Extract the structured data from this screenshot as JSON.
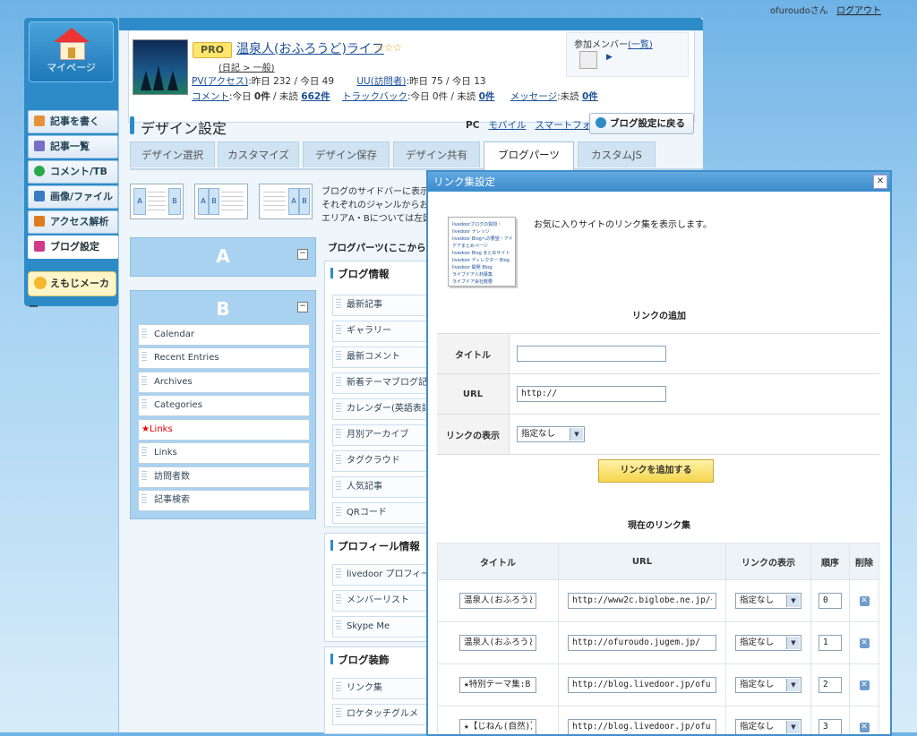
{
  "user": {
    "name": "ofuroudoさん",
    "logout": "ログアウト"
  },
  "nav": {
    "mypage": "マイページ",
    "items": [
      {
        "label": "記事を書く",
        "color": "#e8913a"
      },
      {
        "label": "記事一覧",
        "color": "#7a6fc8"
      },
      {
        "label": "コメント/TB",
        "color": "#2aa84a"
      },
      {
        "label": "画像/ファイル",
        "color": "#3a7cc4"
      },
      {
        "label": "アクセス解析",
        "color": "#e07a1f"
      },
      {
        "label": "ブログ設定",
        "color": "#d23b8a"
      }
    ],
    "emoji": "えもじメーカー"
  },
  "profile": {
    "pro": "PRO",
    "blog_name": "温泉人(おふろうど)ライフ",
    "stars": "☆☆☆",
    "diary": "(日記 > 一般)",
    "pv_label": "PV(アクセス)",
    "pv_text": ":昨日 232 / 今日 49",
    "uu_label": "UU(訪問者)",
    "uu_text": ":昨日 75 / 今日 13",
    "comment_label": "コメント",
    "comment_text": ":今日 ",
    "comment_today": "0件",
    "comment_mid": " / 未読 ",
    "comment_unread": "662件",
    "tb_label": "トラックバック",
    "tb_text": ":今日 0件 / 未読 ",
    "tb_unread": "0件",
    "msg_label": "メッセージ",
    "msg_text": ":未読 ",
    "msg_unread": "0件",
    "members_label": "参加メンバー",
    "members_link": "(一覧)"
  },
  "design": {
    "title": "デザイン設定",
    "pc": "PC",
    "mobile": "モバイル",
    "smartphone": "スマートフォン",
    "back": "ブログ設定に戻る",
    "tabs": [
      "デザイン選択",
      "カスタマイズ",
      "デザイン保存",
      "デザイン共有",
      "ブログパーツ",
      "カスタムJS"
    ],
    "layout_desc": [
      "ブログのサイドバーに表示",
      "それぞれのジャンルからお",
      "エリアA・Bについては左図"
    ]
  },
  "areas": {
    "a": "A",
    "b": "B",
    "b_items": [
      "Calendar",
      "Recent Entries",
      "Archives",
      "Categories",
      "★Links",
      "Links",
      "訪問者数",
      "記事検索"
    ]
  },
  "parts": {
    "head": "ブログパーツ(ここから",
    "groups": [
      {
        "title": "ブログ情報",
        "items": [
          "最新記事",
          "ギャラリー",
          "最新コメント",
          "新着テーマブログ記",
          "カレンダー(英語表記",
          "月別アーカイブ",
          "タグクラウド",
          "人気記事",
          "QRコード"
        ]
      },
      {
        "title": "プロフィール情報",
        "items": [
          "livedoor プロフィール",
          "メンバーリスト",
          "Skype Me"
        ]
      },
      {
        "title": "ブログ装飾",
        "items": [
          "リンク集",
          "ロケタッチグルメ"
        ]
      }
    ]
  },
  "dialog": {
    "title": "リンク集設定",
    "close": "✕",
    "thumb_lines": [
      "livedoorブログの質問・",
      "livedoor ナレッジ",
      "livedoor Blogへの要望・アイ",
      "デアまとめページ",
      "livedoor Blog まとめサイト",
      "livedoor ディレクター Blog",
      "livedoor 開発 Blog",
      "ライブドア人材募集",
      "ライブドア会社概要"
    ],
    "description": "お気に入りサイトのリンク集を表示します。",
    "add_heading": "リンクの追加",
    "title_label": "タイトル",
    "title_value": "",
    "url_label": "URL",
    "url_value": "http://",
    "display_label": "リンクの表示",
    "display_value": "指定なし",
    "add_button": "リンクを追加する",
    "current_heading": "現在のリンク集",
    "columns": [
      "タイトル",
      "URL",
      "リンクの表示",
      "順序",
      "削除"
    ],
    "rows": [
      {
        "title": "温泉人(おふろうど",
        "url": "http://www2c.biglobe.ne.jp/~ofurouc",
        "display": "指定なし",
        "order": "0"
      },
      {
        "title": "温泉人(おふろうど",
        "url": "http://ofuroudo.jugem.jp/",
        "display": "指定なし",
        "order": "1"
      },
      {
        "title": "★特別テーマ集:B",
        "url": "http://blog.livedoor.jp/ofuroudo/arc",
        "display": "指定なし",
        "order": "2"
      },
      {
        "title": "★【じねん(自然)】:",
        "url": "http://blog.livedoor.jp/ofuroudo/arc",
        "display": "指定なし",
        "order": "3"
      }
    ]
  }
}
